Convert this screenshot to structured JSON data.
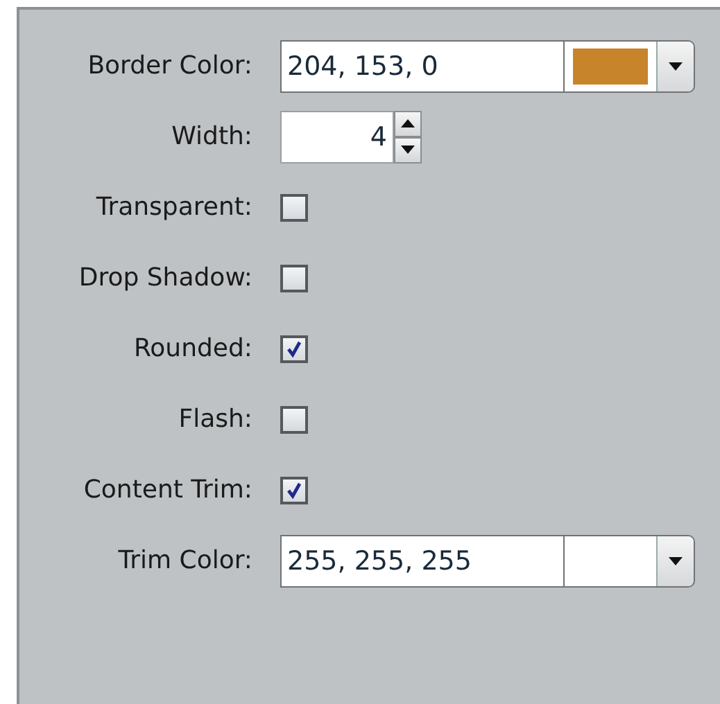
{
  "fields": [
    {
      "kind": "color",
      "label": "Border Color:",
      "value": "204, 153, 0",
      "color": "#c8842a"
    },
    {
      "kind": "spinner",
      "label": "Width:",
      "value": "4"
    },
    {
      "kind": "checkbox",
      "label": "Transparent:",
      "checked": false
    },
    {
      "kind": "checkbox",
      "label": "Drop Shadow:",
      "checked": false
    },
    {
      "kind": "checkbox",
      "label": "Rounded:",
      "checked": true
    },
    {
      "kind": "checkbox",
      "label": "Flash:",
      "checked": false
    },
    {
      "kind": "checkbox",
      "label": "Content Trim:",
      "checked": true
    },
    {
      "kind": "color",
      "label": "Trim Color:",
      "value": "255, 255, 255",
      "color": "#ffffff"
    }
  ]
}
